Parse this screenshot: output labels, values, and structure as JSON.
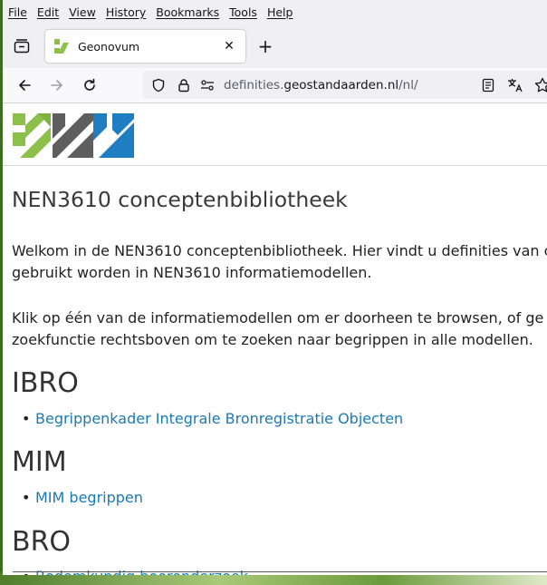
{
  "menubar": {
    "items": [
      "File",
      "Edit",
      "View",
      "History",
      "Bookmarks",
      "Tools",
      "Help"
    ]
  },
  "tab": {
    "title": "Geonovum",
    "close_glyph": "✕"
  },
  "new_tab_glyph": "+",
  "urlbar": {
    "url_prefix": "definities.",
    "url_host": "geostandaarden.nl",
    "url_suffix": "/nl/"
  },
  "page": {
    "title": "NEN3610 conceptenbibliotheek",
    "intro_line1": "Welkom in de NEN3610 conceptenbibliotheek. Hier vindt u definities van c",
    "intro_line2": "gebruikt worden in NEN3610 informatiemodellen.",
    "instr_line1": "Klik op één van de informatiemodellen om er doorheen te browsen, of ge",
    "instr_line2": "zoekfunctie rechtsboven om te zoeken naar begrippen in alle modellen.",
    "sections": [
      {
        "heading": "IBRO",
        "link": "Begrippenkader Integrale Bronregistratie Objecten"
      },
      {
        "heading": "MIM",
        "link": "MIM begrippen"
      },
      {
        "heading": "BRO",
        "link": "Bodemkundig booronderzoek"
      }
    ]
  },
  "colors": {
    "link": "#1a7ab5",
    "logo_green": "#8cc04b",
    "logo_gray": "#5e5e5e",
    "logo_blue": "#1f7dc1"
  },
  "icons": [
    "tab-overview-icon",
    "geonovum-favicon",
    "back-arrow-icon",
    "forward-arrow-icon",
    "reload-icon",
    "shield-icon",
    "lock-icon",
    "permissions-icon",
    "reader-view-icon",
    "translate-icon",
    "bookmark-star-icon"
  ]
}
